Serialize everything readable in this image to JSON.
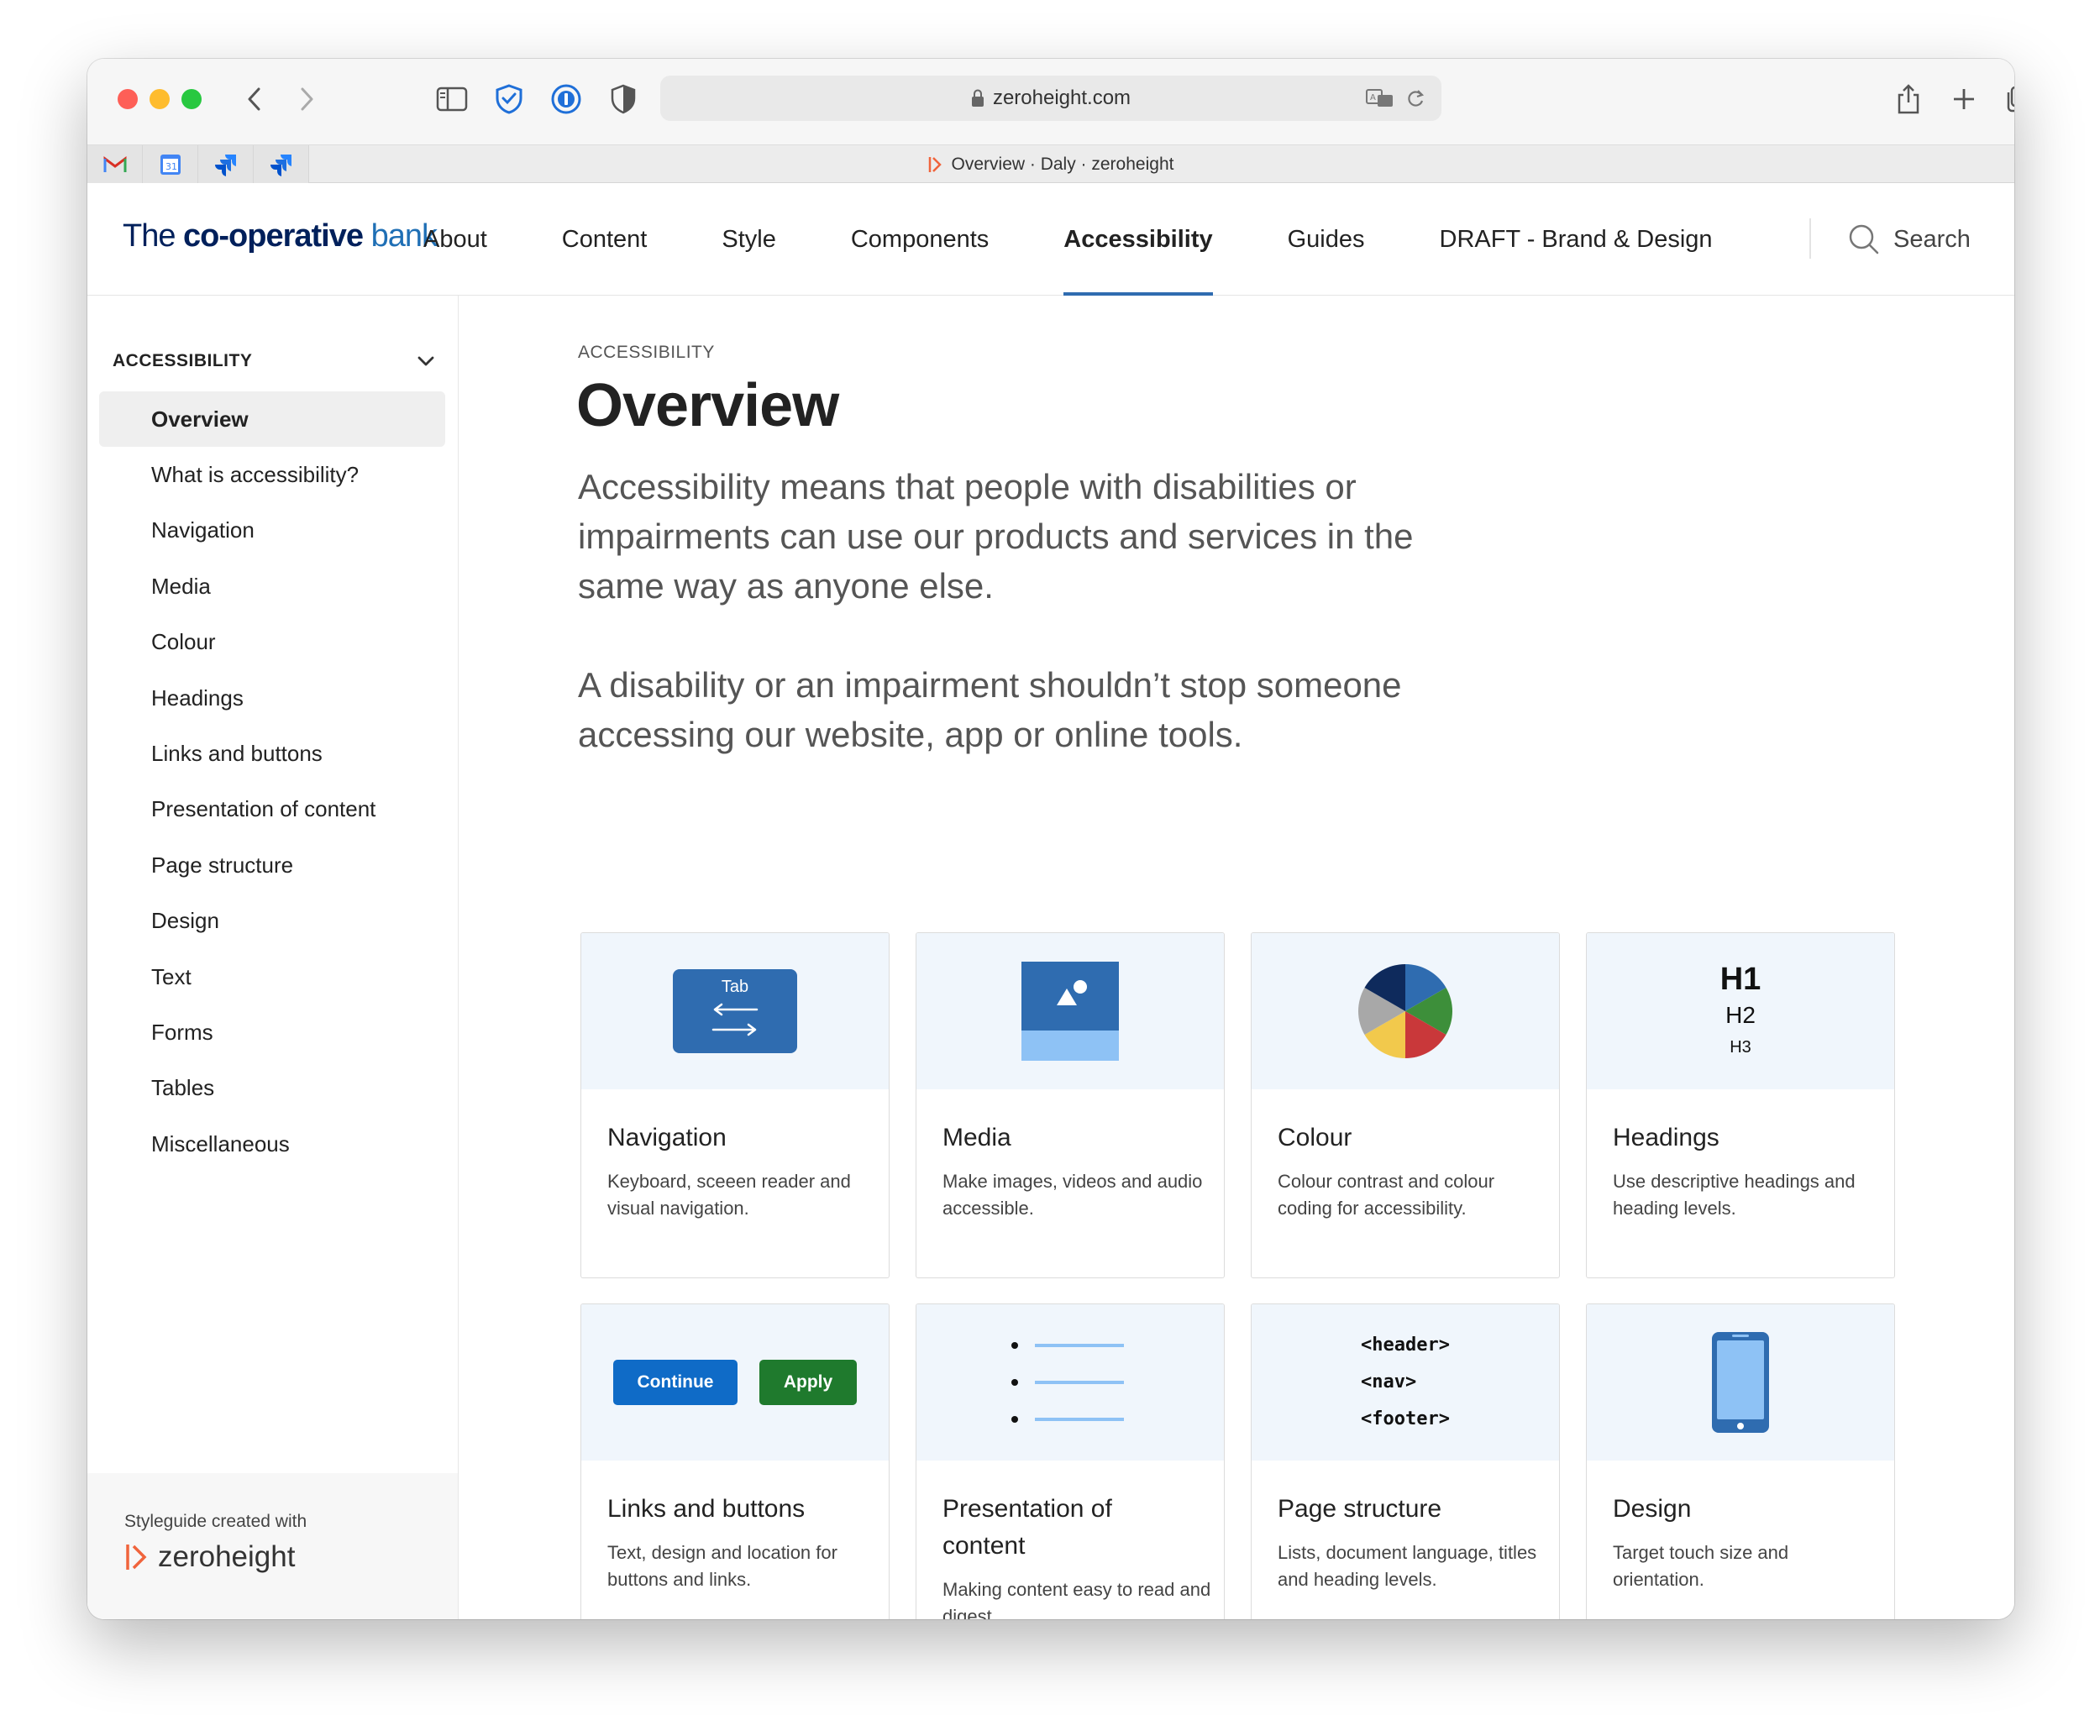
{
  "browser": {
    "url": "zeroheight.com",
    "tab_title": "Overview · Daly · zeroheight"
  },
  "site": {
    "logo": {
      "the": "The ",
      "coop": "co-operative",
      "bank": " bank"
    },
    "nav": [
      "About",
      "Content",
      "Style",
      "Components",
      "Accessibility",
      "Guides",
      "DRAFT - Brand & Design"
    ],
    "active_nav": "Accessibility",
    "search_label": "Search"
  },
  "sidebar": {
    "heading": "ACCESSIBILITY",
    "items": [
      "Overview",
      "What is accessibility?",
      "Navigation",
      "Media",
      "Colour",
      "Headings",
      "Links and buttons",
      "Presentation of content",
      "Page structure",
      "Design",
      "Text",
      "Forms",
      "Tables",
      "Miscellaneous"
    ],
    "active_item": "Overview",
    "footer_text": "Styleguide created with",
    "footer_brand": "zeroheight"
  },
  "main": {
    "eyebrow": "ACCESSIBILITY",
    "title": "Overview",
    "lead1": "Accessibility means that people with disabilities or impairments can use our products and services in the same way as anyone else.",
    "lead2": "A disability or an impairment shouldn’t stop someone accessing our website, app or online tools."
  },
  "cards": [
    {
      "title": "Navigation",
      "desc": "Keyboard, sceeen reader and visual navigation.",
      "art_label": "Tab"
    },
    {
      "title": "Media",
      "desc": "Make images, videos and audio accessible."
    },
    {
      "title": "Colour",
      "desc": "Colour contrast and colour coding for accessibility."
    },
    {
      "title": "Headings",
      "desc": "Use descriptive headings and heading levels.",
      "art": [
        "H1",
        "H2",
        "H3"
      ]
    },
    {
      "title": "Links and buttons",
      "desc": "Text, design and location for buttons and links.",
      "art": [
        "Continue",
        "Apply"
      ]
    },
    {
      "title": "Presentation of content",
      "desc": "Making content easy to read and digest."
    },
    {
      "title": "Page structure",
      "desc": "Lists, document language, titles and heading levels.",
      "art": [
        "<header>",
        "<nav>",
        "<footer>"
      ]
    },
    {
      "title": "Design",
      "desc": "Target touch size and orientation."
    }
  ],
  "colors": {
    "accent": "#2f6cb0",
    "card_art_bg": "#f0f6fc",
    "continue_button": "#0f6bc7",
    "apply_button": "#1f7a2d"
  },
  "icons": [
    "sidebar-icon",
    "shield-check-icon",
    "password-icon",
    "privacy-icon",
    "lock-icon",
    "translate-icon",
    "reload-icon",
    "share-icon",
    "plus-icon",
    "tabs-icon",
    "search-icon",
    "chevron-down-icon",
    "zeroheight-icon"
  ]
}
